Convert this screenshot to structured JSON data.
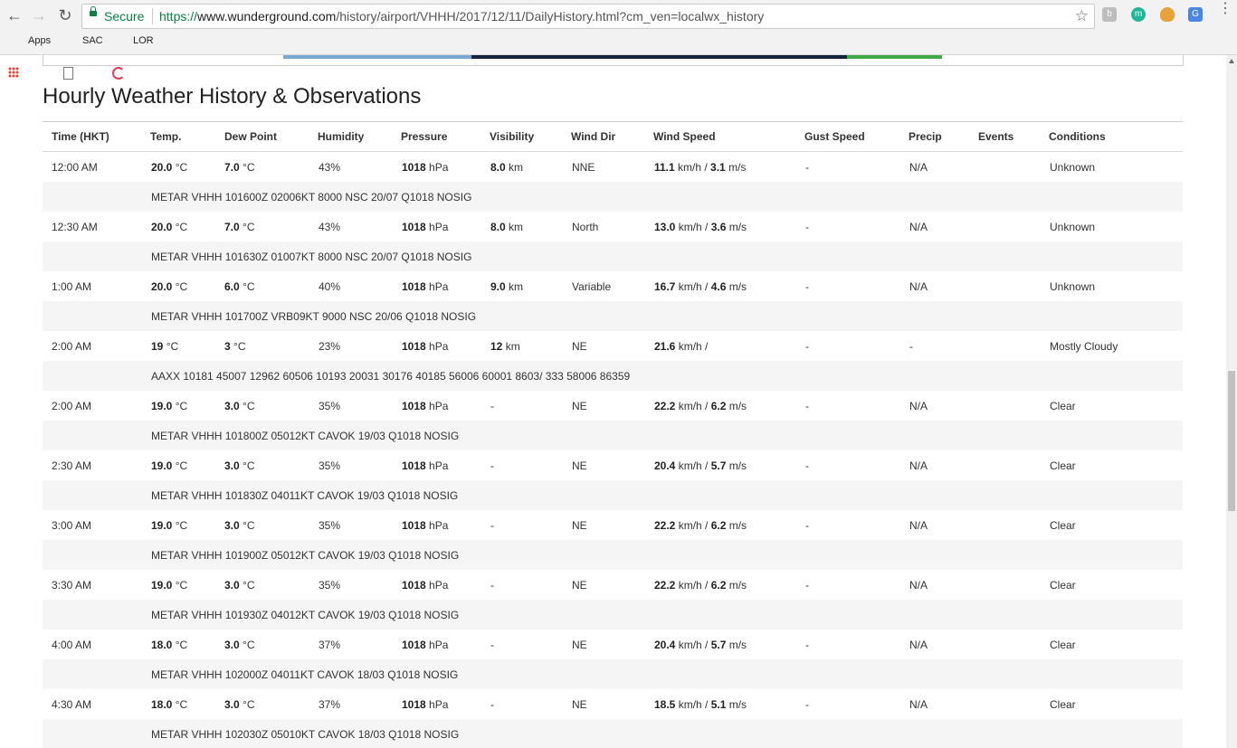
{
  "browser": {
    "secure_label": "Secure",
    "url_scheme": "https://",
    "url_host": "www.wunderground.com",
    "url_path": "/history/airport/VHHH/2017/12/11/DailyHistory.html?cm_ven=localwx_history",
    "extensions": [
      "b",
      "m"
    ],
    "bookmarks": [
      "Apps",
      "SAC",
      "LOR"
    ]
  },
  "page": {
    "heading": "Hourly Weather History & Observations"
  },
  "table": {
    "headers": [
      "Time (HKT)",
      "Temp.",
      "Dew Point",
      "Humidity",
      "Pressure",
      "Visibility",
      "Wind Dir",
      "Wind Speed",
      "Gust Speed",
      "Precip",
      "Events",
      "Conditions"
    ],
    "units": {
      "deg": " °C",
      "hpa": " hPa",
      "km": " km",
      "kmh": " km/h / ",
      "ms": " m/s"
    },
    "rows": [
      {
        "time": "12:00 AM",
        "temp": "20.0",
        "dew": "7.0",
        "hum": "43%",
        "pres": "1018",
        "vis": "8.0",
        "vis_unit": true,
        "dir": "NNE",
        "ws_kmh": "11.1",
        "ws_ms": "3.1",
        "gust": "-",
        "precip": "N/A",
        "events": "",
        "cond": "Unknown",
        "metar": "METAR VHHH 101600Z 02006KT 8000 NSC 20/07 Q1018 NOSIG"
      },
      {
        "time": "12:30 AM",
        "temp": "20.0",
        "dew": "7.0",
        "hum": "43%",
        "pres": "1018",
        "vis": "8.0",
        "vis_unit": true,
        "dir": "North",
        "ws_kmh": "13.0",
        "ws_ms": "3.6",
        "gust": "-",
        "precip": "N/A",
        "events": "",
        "cond": "Unknown",
        "metar": "METAR VHHH 101630Z 01007KT 8000 NSC 20/07 Q1018 NOSIG"
      },
      {
        "time": "1:00 AM",
        "temp": "20.0",
        "dew": "6.0",
        "hum": "40%",
        "pres": "1018",
        "vis": "9.0",
        "vis_unit": true,
        "dir": "Variable",
        "ws_kmh": "16.7",
        "ws_ms": "4.6",
        "gust": "-",
        "precip": "N/A",
        "events": "",
        "cond": "Unknown",
        "metar": "METAR VHHH 101700Z VRB09KT 9000 NSC 20/06 Q1018 NOSIG"
      },
      {
        "time": "2:00 AM",
        "temp": "19",
        "dew": "3",
        "hum": "23%",
        "pres": "1018",
        "vis": "12",
        "vis_unit": true,
        "dir": "NE",
        "ws_kmh": "21.6",
        "ws_ms": "",
        "gust": "-",
        "precip": "-",
        "events": "",
        "cond": "Mostly Cloudy",
        "metar": "AAXX 10181 45007 12962 60506 10193 20031 30176 40185 56006 60001 8603/ 333 58006 86359"
      },
      {
        "time": "2:00 AM",
        "temp": "19.0",
        "dew": "3.0",
        "hum": "35%",
        "pres": "1018",
        "vis": "-",
        "vis_unit": false,
        "dir": "NE",
        "ws_kmh": "22.2",
        "ws_ms": "6.2",
        "gust": "-",
        "precip": "N/A",
        "events": "",
        "cond": "Clear",
        "metar": "METAR VHHH 101800Z 05012KT CAVOK 19/03 Q1018 NOSIG"
      },
      {
        "time": "2:30 AM",
        "temp": "19.0",
        "dew": "3.0",
        "hum": "35%",
        "pres": "1018",
        "vis": "-",
        "vis_unit": false,
        "dir": "NE",
        "ws_kmh": "20.4",
        "ws_ms": "5.7",
        "gust": "-",
        "precip": "N/A",
        "events": "",
        "cond": "Clear",
        "metar": "METAR VHHH 101830Z 04011KT CAVOK 19/03 Q1018 NOSIG"
      },
      {
        "time": "3:00 AM",
        "temp": "19.0",
        "dew": "3.0",
        "hum": "35%",
        "pres": "1018",
        "vis": "-",
        "vis_unit": false,
        "dir": "NE",
        "ws_kmh": "22.2",
        "ws_ms": "6.2",
        "gust": "-",
        "precip": "N/A",
        "events": "",
        "cond": "Clear",
        "metar": "METAR VHHH 101900Z 05012KT CAVOK 19/03 Q1018 NOSIG"
      },
      {
        "time": "3:30 AM",
        "temp": "19.0",
        "dew": "3.0",
        "hum": "35%",
        "pres": "1018",
        "vis": "-",
        "vis_unit": false,
        "dir": "NE",
        "ws_kmh": "22.2",
        "ws_ms": "6.2",
        "gust": "-",
        "precip": "N/A",
        "events": "",
        "cond": "Clear",
        "metar": "METAR VHHH 101930Z 04012KT CAVOK 19/03 Q1018 NOSIG"
      },
      {
        "time": "4:00 AM",
        "temp": "18.0",
        "dew": "3.0",
        "hum": "37%",
        "pres": "1018",
        "vis": "-",
        "vis_unit": false,
        "dir": "NE",
        "ws_kmh": "20.4",
        "ws_ms": "5.7",
        "gust": "-",
        "precip": "N/A",
        "events": "",
        "cond": "Clear",
        "metar": "METAR VHHH 102000Z 04011KT CAVOK 18/03 Q1018 NOSIG"
      },
      {
        "time": "4:30 AM",
        "temp": "18.0",
        "dew": "3.0",
        "hum": "37%",
        "pres": "1018",
        "vis": "-",
        "vis_unit": false,
        "dir": "NE",
        "ws_kmh": "18.5",
        "ws_ms": "5.1",
        "gust": "-",
        "precip": "N/A",
        "events": "",
        "cond": "Clear",
        "metar": "METAR VHHH 102030Z 05010KT CAVOK 18/03 Q1018 NOSIG"
      }
    ]
  },
  "colors": {
    "ad_blue": "#7aa7d1",
    "ad_navy": "#13233f",
    "ad_green": "#3fab48"
  }
}
